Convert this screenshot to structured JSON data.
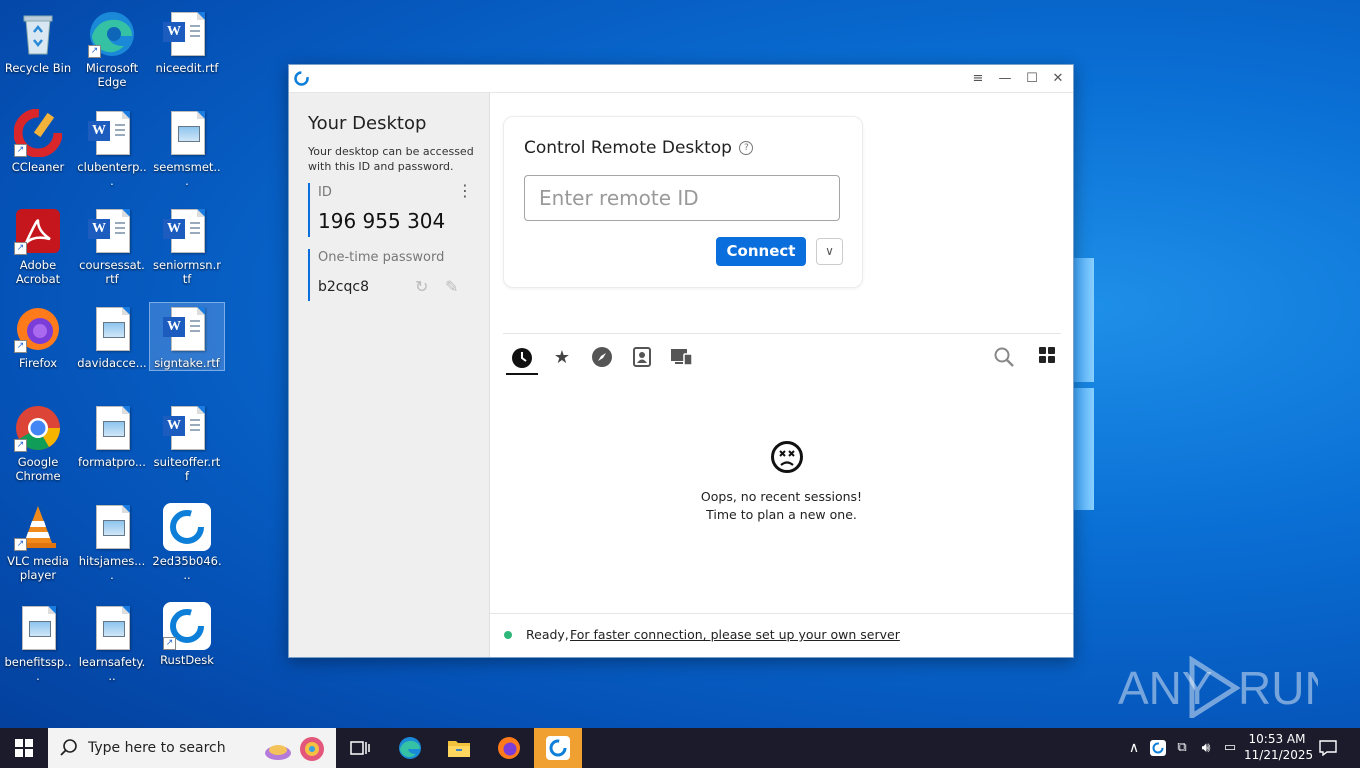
{
  "desktop": {
    "icons": [
      {
        "label": "Recycle Bin"
      },
      {
        "label": "Microsoft Edge"
      },
      {
        "label": "niceedit.rtf"
      },
      {
        "label": "CCleaner"
      },
      {
        "label": "clubenterp..."
      },
      {
        "label": "seemsmet..."
      },
      {
        "label": "Adobe Acrobat"
      },
      {
        "label": "coursessat.rtf"
      },
      {
        "label": "seniormsn.rtf"
      },
      {
        "label": "Firefox"
      },
      {
        "label": "davidacce..."
      },
      {
        "label": "signtake.rtf"
      },
      {
        "label": "Google Chrome"
      },
      {
        "label": "formatpro..."
      },
      {
        "label": "suiteoffer.rtf"
      },
      {
        "label": "VLC media player"
      },
      {
        "label": "hitsjames...."
      },
      {
        "label": "2ed35b046..."
      },
      {
        "label": "benefitssp..."
      },
      {
        "label": "learnsafety..."
      },
      {
        "label": "RustDesk"
      }
    ],
    "watermark": "ANY RUN"
  },
  "window": {
    "left": {
      "title": "Your Desktop",
      "description": "Your desktop can be accessed with this ID and password.",
      "id_label": "ID",
      "id_value": "196 955 304",
      "password_label": "One-time password",
      "password_value": "b2cqc8"
    },
    "control": {
      "title": "Control Remote Desktop",
      "input_placeholder": "Enter remote ID",
      "connect_label": "Connect"
    },
    "empty": {
      "line1": "Oops, no recent sessions!",
      "line2": "Time to plan a new one."
    },
    "status": {
      "ready": "Ready,",
      "link": "For faster connection, please set up your own server"
    },
    "colors": {
      "accent": "#0a6edc",
      "status_dot": "#2fb679"
    }
  },
  "taskbar": {
    "search_placeholder": "Type here to search",
    "time": "10:53 AM",
    "date": "11/21/2025"
  }
}
